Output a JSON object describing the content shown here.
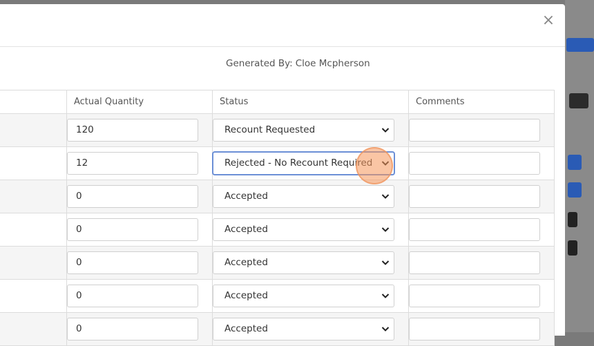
{
  "header": {
    "close_label": "×"
  },
  "report": {
    "generated_by_label": "Generated By:",
    "generated_by_name": "Cloe Mcpherson"
  },
  "table": {
    "columns": [
      "Actual Quantity",
      "Status",
      "Comments"
    ],
    "rows": [
      {
        "actual_quantity": "120",
        "status": "Recount Requested",
        "comment": ""
      },
      {
        "actual_quantity": "12",
        "status": "Rejected - No Recount Required",
        "comment": ""
      },
      {
        "actual_quantity": "0",
        "status": "Accepted",
        "comment": ""
      },
      {
        "actual_quantity": "0",
        "status": "Accepted",
        "comment": ""
      },
      {
        "actual_quantity": "0",
        "status": "Accepted",
        "comment": ""
      },
      {
        "actual_quantity": "0",
        "status": "Accepted",
        "comment": ""
      },
      {
        "actual_quantity": "0",
        "status": "Accepted",
        "comment": ""
      }
    ]
  },
  "icons": {
    "close": "close-icon",
    "dropdown": "chevron-down-icon"
  },
  "colors": {
    "focus": "#6b8fd6",
    "cursor_highlight": "#f5965a"
  }
}
